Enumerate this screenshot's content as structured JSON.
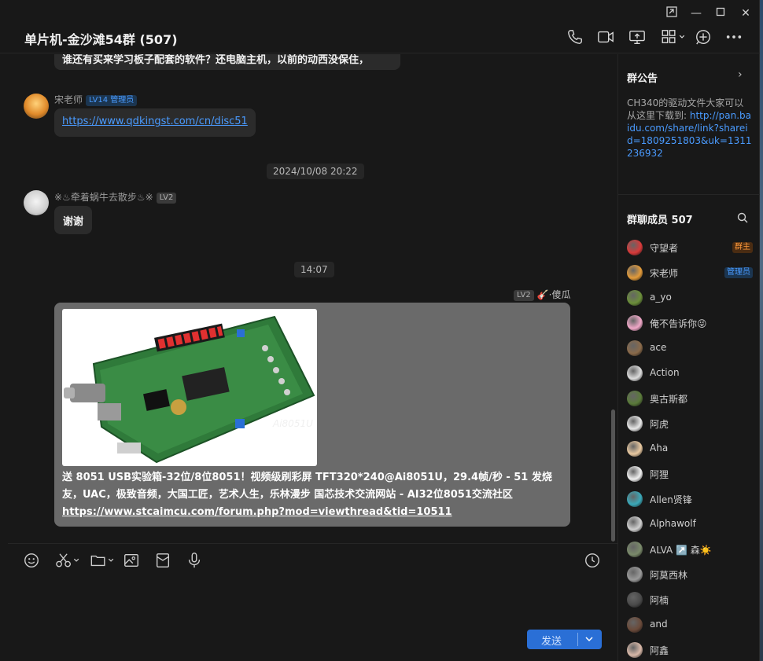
{
  "window": {
    "title": "单片机-金沙滩54群 (507)"
  },
  "messages": {
    "partial_text": "谁还有买来学习板子配套的软件？还电脑主机，以前的动西没保住，",
    "msg1": {
      "sender": "宋老师",
      "badge": "LV14 管理员",
      "link": "https://www.qdkingst.com/cn/disc51"
    },
    "time1": "2024/10/08 20:22",
    "msg2": {
      "sender": "※♨牵着蜗牛去散步♨※",
      "badge": "LV2",
      "text": "谢谢"
    },
    "time2": "14:07",
    "msg3": {
      "sender": "🎸·傻瓜",
      "badge": "LV2",
      "text": "送 8051 USB实验箱-32位/8位8051！视频级刷彩屏 TFT320*240@Ai8051U，29.4帧/秒 - 51 发烧友，UAC，极致音频，大国工匠，艺术人生，乐林漫步 国芯技术交流网站 - AI32位8051交流社区 ",
      "link": "https://www.stcaimcu.com/forum.php?mod=viewthread&tid=10511",
      "image_alt": "Ai8051U"
    }
  },
  "composer": {
    "send_label": "发送"
  },
  "panel": {
    "notice_title": "群公告",
    "notice_text": "CH340的驱动文件大家可以从这里下载到: ",
    "notice_link": "http://pan.baidu.com/share/link?shareid=1809251803&uk=1311236932",
    "members_title": "群聊成员 507",
    "members": [
      {
        "name": "守望者",
        "role": "群主",
        "color": "#d83a3a"
      },
      {
        "name": "宋老师",
        "role": "管理员",
        "color": "#e39b3a"
      },
      {
        "name": "a_yo",
        "role": "",
        "color": "#6b8e3a"
      },
      {
        "name": "俺不告诉你😜",
        "role": "",
        "color": "#f0a8c8"
      },
      {
        "name": "ace",
        "role": "",
        "color": "#8a6a4a"
      },
      {
        "name": "Action",
        "role": "",
        "color": "#dcdcdc"
      },
      {
        "name": "奥古斯都",
        "role": "",
        "color": "#5a7a3a"
      },
      {
        "name": "阿虎",
        "role": "",
        "color": "#e8e8e8"
      },
      {
        "name": "Aha",
        "role": "",
        "color": "#e8c8a0"
      },
      {
        "name": "阿狸",
        "role": "",
        "color": "#f0f0f0"
      },
      {
        "name": "Allen贤锋",
        "role": "",
        "color": "#3aa8b8"
      },
      {
        "name": "Alphawolf",
        "role": "",
        "color": "#cfcfcf"
      },
      {
        "name": "ALVA ↗️ 森☀️",
        "role": "",
        "color": "#7a8a6a"
      },
      {
        "name": "阿莫西林",
        "role": "",
        "color": "#9a9a9a"
      },
      {
        "name": "阿楠",
        "role": "",
        "color": "#4a4a4a"
      },
      {
        "name": "and",
        "role": "",
        "color": "#6a4a3a"
      },
      {
        "name": "阿鑫",
        "role": "",
        "color": "#d8b8a8"
      }
    ]
  },
  "colors": {
    "accent": "#2a6fd6",
    "link": "#4a9bff",
    "owner_badge": "#ff9a3c"
  }
}
